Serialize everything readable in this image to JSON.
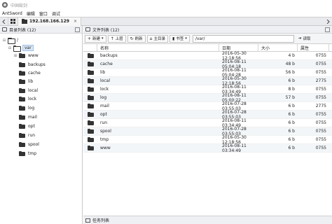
{
  "window": {
    "title": "中国蚁剑"
  },
  "menu": {
    "items": [
      "AntSword",
      "编辑",
      "窗口",
      "调试"
    ]
  },
  "tabs": [
    {
      "label": "192.168.166.129"
    }
  ],
  "left_panel": {
    "title": "目录列表 (12)",
    "tree": {
      "root": "/",
      "selected": "var",
      "children": [
        "www",
        "backups",
        "cache",
        "lib",
        "local",
        "lock",
        "log",
        "mail",
        "opt",
        "run",
        "spool",
        "tmp"
      ]
    }
  },
  "right_panel": {
    "title": "文件列表 (12)",
    "toolbar": {
      "new_label": "新建",
      "up_label": "上层",
      "refresh_label": "刷新",
      "home_label": "主目录",
      "bookmark_label": "书签",
      "read_label": "读取"
    },
    "path": "/var/",
    "columns": [
      "名称",
      "日期",
      "大小",
      "属性"
    ],
    "files": [
      {
        "name": "backups",
        "date": "2016-05-30 12:18:56",
        "size": "4 b",
        "perm": "0755"
      },
      {
        "name": "cache",
        "date": "2016-08-11 05:04:18",
        "size": "48 b",
        "perm": "0755"
      },
      {
        "name": "lib",
        "date": "2016-08-11 05:04:28",
        "size": "56 b",
        "perm": "0755"
      },
      {
        "name": "local",
        "date": "2016-05-30 12:18:56",
        "size": "6 b",
        "perm": "2775"
      },
      {
        "name": "lock",
        "date": "2016-08-11 03:34:49",
        "size": "8 b",
        "perm": "0755"
      },
      {
        "name": "log",
        "date": "2016-08-11 05:00:22",
        "size": "57 b",
        "perm": "0755"
      },
      {
        "name": "mail",
        "date": "2016-07-28 03:55:03",
        "size": "6 b",
        "perm": "2775"
      },
      {
        "name": "opt",
        "date": "2016-07-28 03:55:03",
        "size": "6 b",
        "perm": "0755"
      },
      {
        "name": "run",
        "date": "2016-08-11 03:34:49",
        "size": "6 b",
        "perm": "0755"
      },
      {
        "name": "spool",
        "date": "2016-07-28 03:55:03",
        "size": "6 b",
        "perm": "0755"
      },
      {
        "name": "tmp",
        "date": "2016-05-30 12:18:56",
        "size": "6 b",
        "perm": "0755"
      },
      {
        "name": "www",
        "date": "2016-08-11 03:34:49",
        "size": "6 b",
        "perm": "0755"
      }
    ]
  },
  "bottom_bar": {
    "title": "任务列表"
  },
  "colors": {
    "accent": "#9ec0e6",
    "row_alt": "#f3f6f9",
    "header_bg": "#eef0f3"
  }
}
